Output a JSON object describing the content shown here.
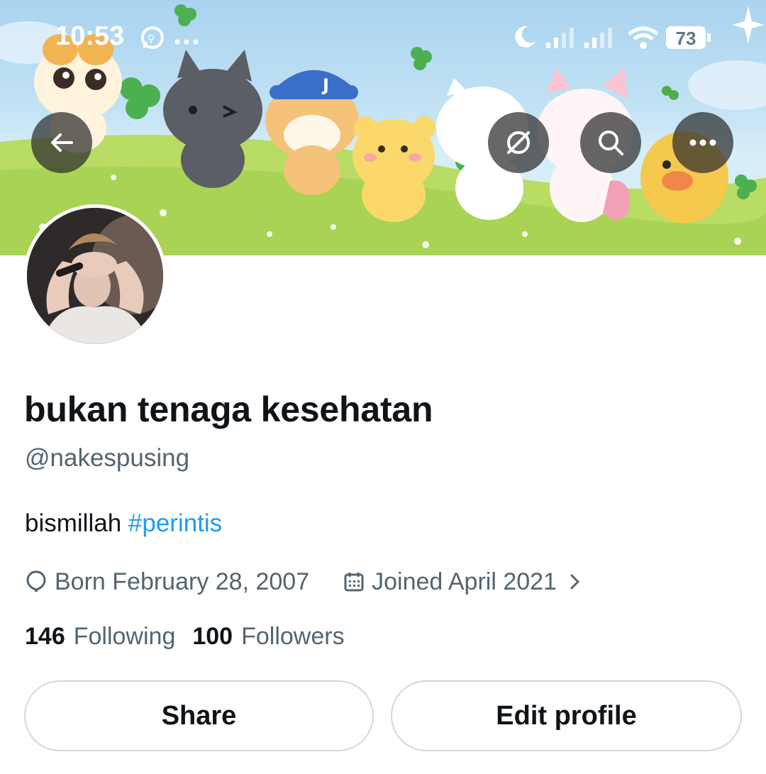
{
  "status_bar": {
    "time": "10:53",
    "battery": "73",
    "icons": [
      "whatsapp-icon",
      "more-dots-icon",
      "moon-icon",
      "signal-icon",
      "signal-icon",
      "wifi-icon",
      "battery-icon"
    ]
  },
  "header": {
    "back_icon": "arrow-left-icon",
    "actions": [
      "translate-icon",
      "search-icon",
      "more-icon"
    ]
  },
  "profile": {
    "display_name": "bukan tenaga kesehatan",
    "handle": "@nakespusing",
    "bio_text": "bismillah ",
    "bio_hashtag": "#perintis",
    "born": "Born February 28, 2007",
    "joined": "Joined April 2021",
    "following_count": "146",
    "following_label": "Following",
    "followers_count": "100",
    "followers_label": "Followers"
  },
  "buttons": {
    "share_label": "Share",
    "edit_label": "Edit profile"
  },
  "colors": {
    "link": "#1d9bf0",
    "secondary_text": "#536471",
    "primary_text": "#0f1419",
    "border": "#cfd9de"
  }
}
